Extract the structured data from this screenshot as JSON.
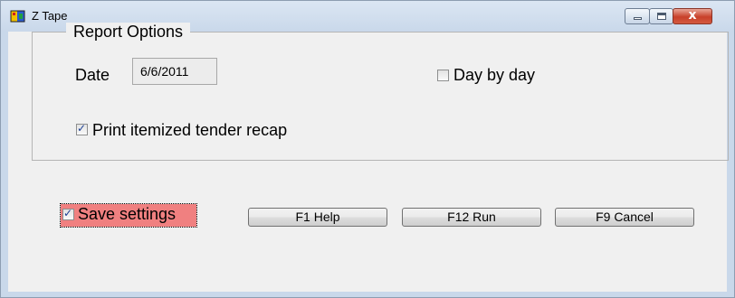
{
  "window": {
    "title": "Z Tape"
  },
  "report_options": {
    "group_title": "Report Options",
    "date_label": "Date",
    "date_value": "6/6/2011",
    "day_by_day_label": "Day by day",
    "day_by_day_checked": false,
    "print_itemized_label": "Print itemized tender recap",
    "print_itemized_checked": true
  },
  "save_settings": {
    "label": "Save settings",
    "checked": true,
    "highlight_color": "#f08080"
  },
  "buttons": {
    "help": "F1 Help",
    "run": "F12 Run",
    "cancel": "F9 Cancel"
  },
  "title_buttons": {
    "minimize": "minimize-icon",
    "maximize": "maximize-icon",
    "close": "close-icon"
  }
}
